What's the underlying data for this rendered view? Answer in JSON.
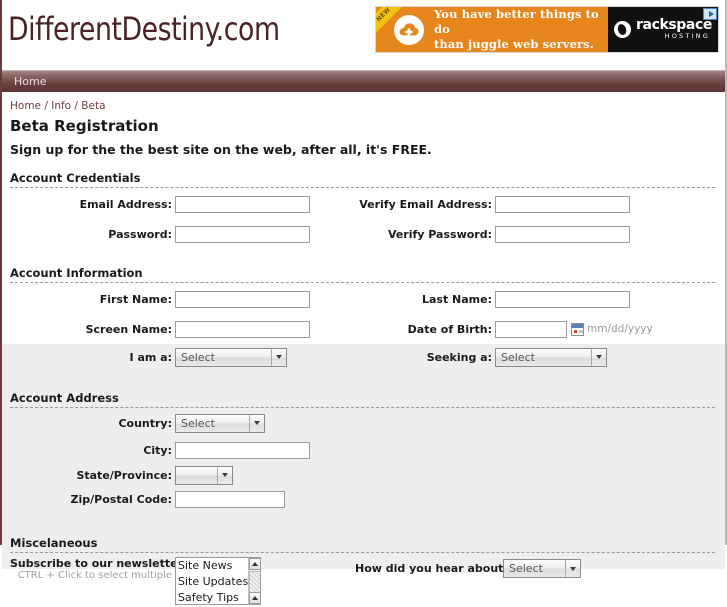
{
  "site": {
    "logo_text": "DifferentDestiny.com"
  },
  "ad": {
    "ribbon_label": "NEW",
    "headline_line1": "You have better things to do",
    "headline_line2": "than juggle web servers.",
    "brand_name": "rackspace",
    "brand_sub": "HOSTING",
    "cloud_icon": "cloud-plus-icon",
    "adchoices_icon": "adchoices-icon"
  },
  "nav": {
    "items": [
      {
        "label": "Home"
      }
    ]
  },
  "breadcrumb": {
    "items": [
      "Home",
      "Info",
      "Beta"
    ],
    "separator": "/",
    "text": "Home / Info / Beta"
  },
  "page": {
    "title": "Beta Registration",
    "subtitle": "Sign up for the the best site on the web, after all, it's FREE."
  },
  "sections": {
    "credentials": {
      "title": "Account Credentials",
      "fields": {
        "email_label": "Email Address:",
        "email_value": "",
        "verify_email_label": "Verify Email Address:",
        "verify_email_value": "",
        "password_label": "Password:",
        "password_value": "",
        "verify_password_label": "Verify Password:",
        "verify_password_value": ""
      }
    },
    "information": {
      "title": "Account Information",
      "fields": {
        "first_name_label": "First Name:",
        "first_name_value": "",
        "last_name_label": "Last Name:",
        "last_name_value": "",
        "screen_name_label": "Screen Name:",
        "screen_name_value": "",
        "dob_label": "Date of Birth:",
        "dob_value": "",
        "dob_format_hint": "mm/dd/yyyy",
        "dob_icon": "calendar-icon",
        "i_am_a_label": "I am a:",
        "i_am_a_value": "Select",
        "seeking_a_label": "Seeking a:",
        "seeking_a_value": "Select"
      }
    },
    "address": {
      "title": "Account Address",
      "fields": {
        "country_label": "Country:",
        "country_value": "Select",
        "city_label": "City:",
        "city_value": "",
        "state_label": "State/Province:",
        "state_value": "",
        "zip_label": "Zip/Postal Code:",
        "zip_value": ""
      }
    },
    "misc": {
      "title": "Miscelaneous",
      "fields": {
        "newsletter_label": "Subscribe to our newsletters:",
        "newsletter_hint": "CTRL + Click to select multiple",
        "newsletter_options": [
          "Site News",
          "Site Updates",
          "Safety Tips"
        ],
        "referral_label": "How did you hear about us:",
        "referral_value": "Select"
      }
    }
  },
  "colors": {
    "brand_maroon": "#6b3f3f",
    "logo": "#4a2424",
    "ad_orange": "#e8861e",
    "ad_ribbon": "#f2c313",
    "band_grey": "#eeeeee"
  }
}
